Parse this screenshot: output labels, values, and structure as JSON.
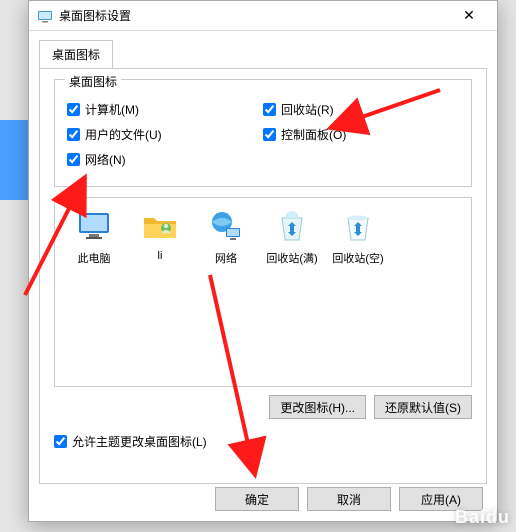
{
  "window": {
    "title": "桌面图标设置",
    "close_glyph": "✕"
  },
  "tab": {
    "label": "桌面图标"
  },
  "fieldset": {
    "legend": "桌面图标"
  },
  "checks": {
    "computer": "计算机(M)",
    "recycle": "回收站(R)",
    "userfiles": "用户的文件(U)",
    "ctrlpanel": "控制面板(O)",
    "network": "网络(N)"
  },
  "icons": {
    "thispc": "此电脑",
    "user": "li",
    "network": "网络",
    "binfull": "回收站(满)",
    "binempty": "回收站(空)"
  },
  "buttons": {
    "change_icon": "更改图标(H)...",
    "restore": "还原默认值(S)",
    "ok": "确定",
    "cancel": "取消",
    "apply": "应用(A)"
  },
  "allow_themes": "允许主题更改桌面图标(L)",
  "watermark": "Baidu"
}
